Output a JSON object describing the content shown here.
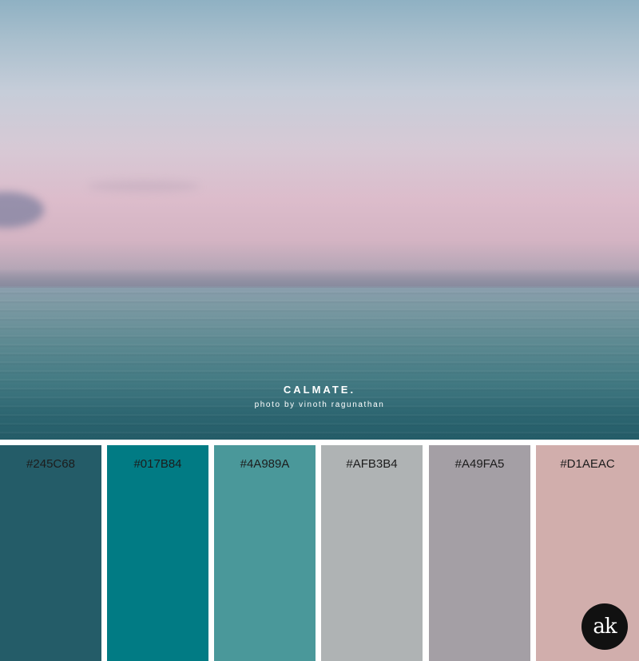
{
  "photo": {
    "caption_title": "CALMATE.",
    "caption_credit": "photo by vinoth ragunathan"
  },
  "palette": [
    {
      "label": "#245C68",
      "color": "#245C68"
    },
    {
      "label": "#017B84",
      "color": "#017B84"
    },
    {
      "label": "#4A989A",
      "color": "#4A989A"
    },
    {
      "label": "#AFB3B4",
      "color": "#AFB3B4"
    },
    {
      "label": "#A49FA5",
      "color": "#A49FA5"
    },
    {
      "label": "#D1AEAC",
      "color": "#D1AEAC"
    }
  ],
  "logo": {
    "text": "ak"
  }
}
